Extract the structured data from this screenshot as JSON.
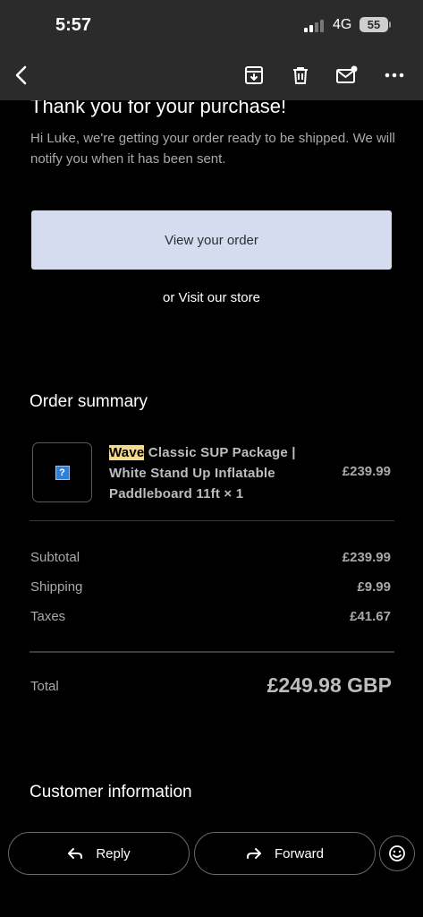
{
  "status_bar": {
    "time": "5:57",
    "network": "4G",
    "battery": "55"
  },
  "toolbar": {
    "back_icon": "chevron-left-icon",
    "archive_icon": "archive-icon",
    "delete_icon": "trash-icon",
    "unread_icon": "mail-unread-icon",
    "more_icon": "more-horizontal-icon"
  },
  "email": {
    "heading": "Thank you for your purchase!",
    "intro": "Hi Luke, we're getting your order ready to be shipped. We will notify you when it has been sent.",
    "view_order_label": "View your order",
    "visit_store_label": "or Visit our store",
    "order_summary_title": "Order summary",
    "item": {
      "highlighted_word": "Wave",
      "title_rest": " Classic SUP Package | White Stand Up Inflatable Paddleboard 11ft × 1",
      "price": "£239.99",
      "thumbnail_icon": "broken-image-icon",
      "thumbnail_glyph": "?"
    },
    "totals": [
      {
        "label": "Subtotal",
        "value": "£239.99"
      },
      {
        "label": "Shipping",
        "value": "£9.99"
      },
      {
        "label": "Taxes",
        "value": "£41.67"
      }
    ],
    "total_label": "Total",
    "total_value": "£249.98 GBP",
    "customer_info_title": "Customer information"
  },
  "actions": {
    "reply_label": "Reply",
    "forward_label": "Forward",
    "reply_icon": "reply-icon",
    "forward_icon": "forward-icon",
    "emoji_icon": "smiley-icon"
  },
  "colors": {
    "background": "#000000",
    "bar_background": "#2b2b2b",
    "button_background": "#d5dcf0",
    "highlight": "#f3d98a"
  }
}
